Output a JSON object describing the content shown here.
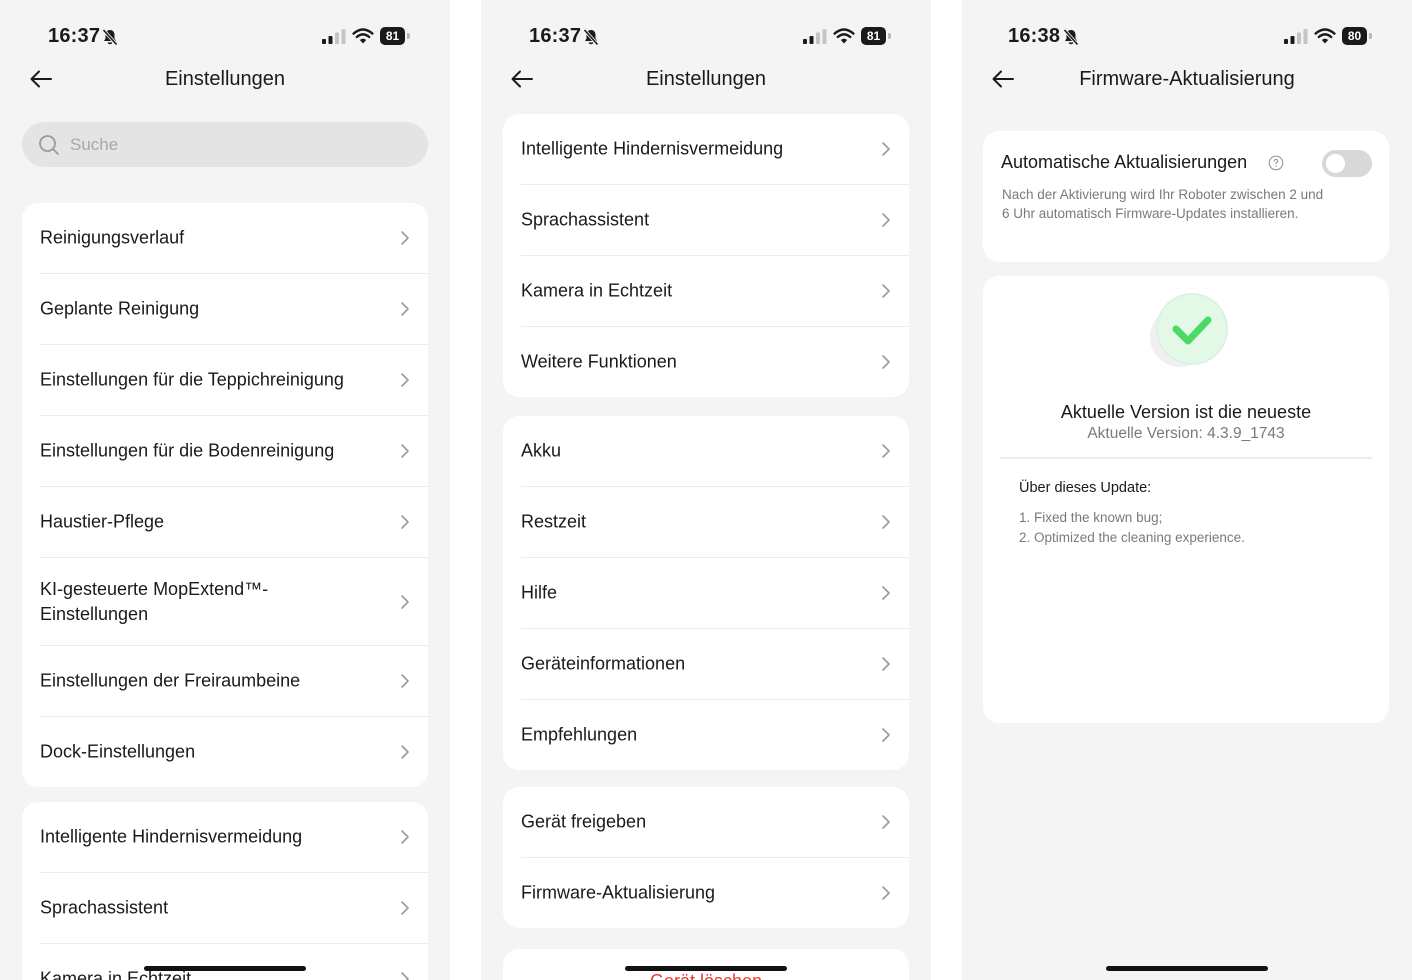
{
  "screens": [
    {
      "time": "16:37",
      "battery": "81",
      "title": "Einstellungen",
      "search_placeholder": "Suche",
      "group1": [
        "Reinigungsverlauf",
        "Geplante Reinigung",
        "Einstellungen für die Teppichreinigung",
        "Einstellungen für die Bodenreinigung",
        "Haustier-Pflege",
        "KI-gesteuerte MopExtend™-Einstellungen",
        "Einstellungen der Freiraumbeine",
        "Dock-Einstellungen"
      ],
      "group2": [
        "Intelligente Hindernisvermeidung",
        "Sprachassistent",
        "Kamera in Echtzeit"
      ]
    },
    {
      "time": "16:37",
      "battery": "81",
      "title": "Einstellungen",
      "group1": [
        "Intelligente Hindernisvermeidung",
        "Sprachassistent",
        "Kamera in Echtzeit",
        "Weitere Funktionen"
      ],
      "group2": [
        "Akku",
        "Restzeit",
        "Hilfe",
        "Geräteinformationen",
        "Empfehlungen"
      ],
      "group3": [
        "Gerät freigeben",
        "Firmware-Aktualisierung"
      ],
      "danger_label": "Gerät löschen"
    },
    {
      "time": "16:38",
      "battery": "80",
      "title": "Firmware-Aktualisierung",
      "auto_update_title": "Automatische Aktualisierungen",
      "auto_update_desc": "Nach der Aktivierung wird Ihr Roboter zwischen 2 und 6 Uhr automatisch Firmware-Updates installieren.",
      "auto_update_enabled": false,
      "version_headline": "Aktuelle Version ist die neueste",
      "version_label": "Aktuelle Version: 4.3.9_1743",
      "about_title": "Über dieses Update:",
      "release_notes": [
        "1. Fixed the known bug;",
        "2. Optimized the cleaning experience."
      ]
    }
  ],
  "colors": {
    "screen_bg": "#f4f4f4",
    "card_bg": "#ffffff",
    "danger": "#e53935",
    "success": "#4cd964",
    "toggle_off": "#d8d8d8"
  },
  "icons": [
    "back-arrow-icon",
    "search-icon",
    "chevron-right-icon",
    "bell-mute-icon",
    "signal-icon",
    "wifi-icon",
    "battery-icon",
    "help-circle-icon",
    "check-icon"
  ]
}
